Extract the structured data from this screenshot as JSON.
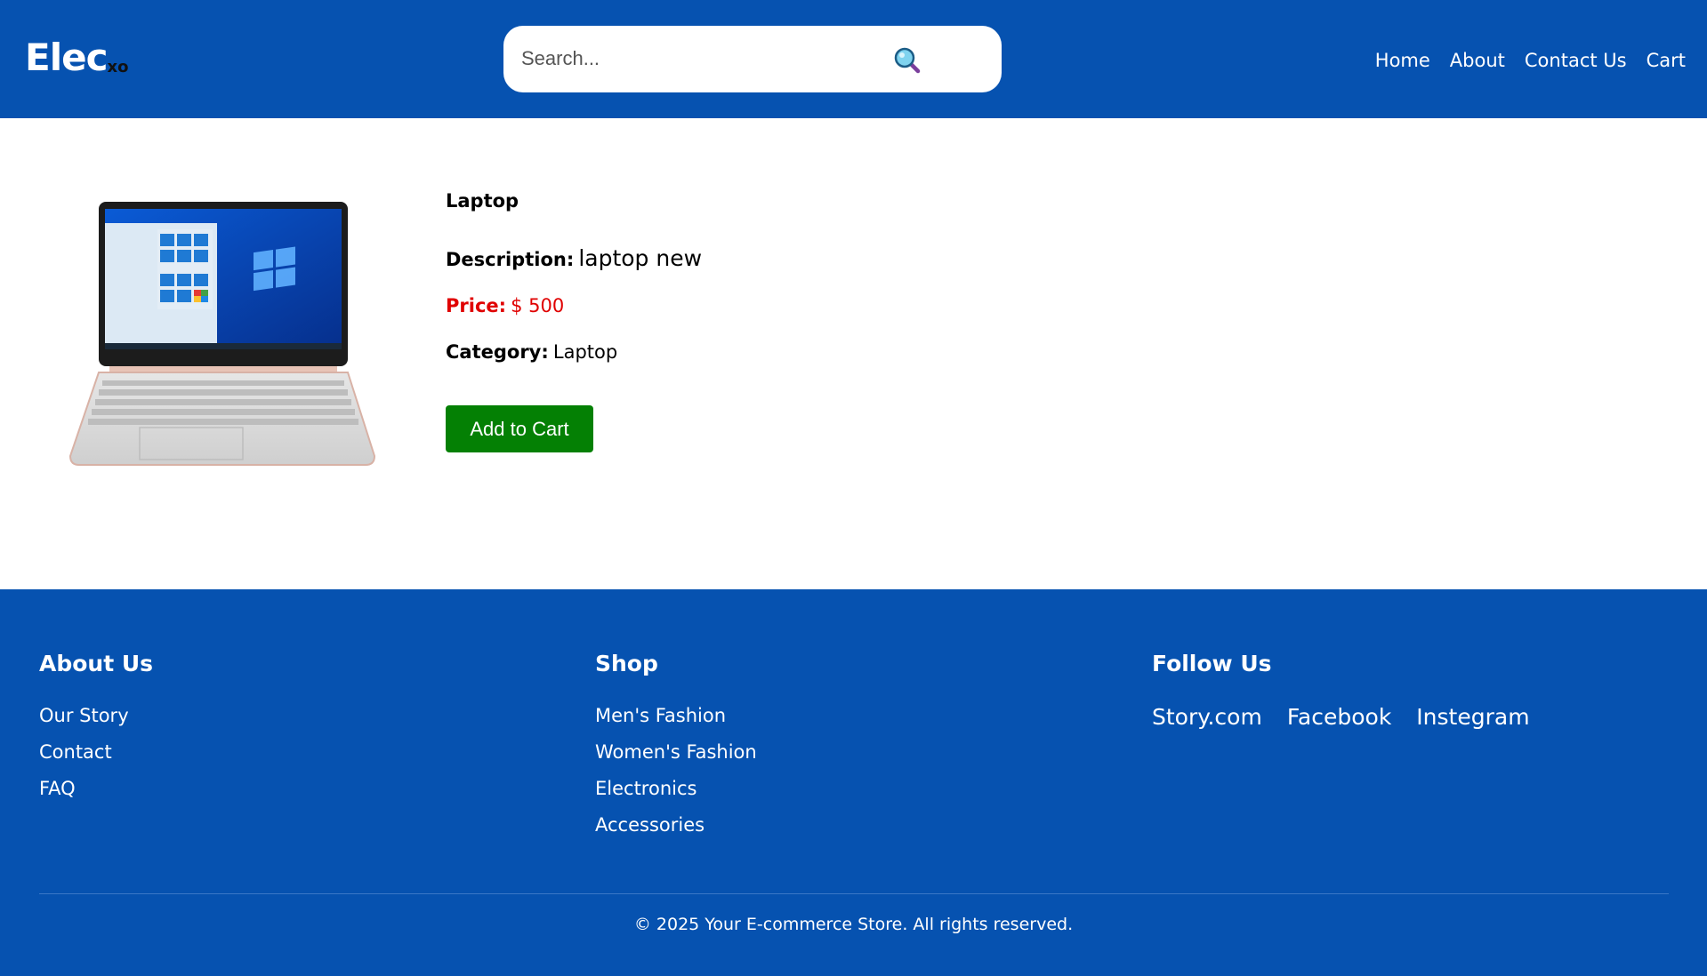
{
  "header": {
    "logo_main": "Elec",
    "logo_sub": "xo",
    "search_placeholder": "Search...",
    "search_icon": "search-icon",
    "nav": [
      "Home",
      "About",
      "Contact Us",
      "Cart"
    ]
  },
  "product": {
    "title": "Laptop",
    "description_label": "Description:",
    "description": "laptop new",
    "price_label": "Price:",
    "price": "$ 500",
    "category_label": "Category:",
    "category": "Laptop",
    "add_to_cart_label": "Add to Cart"
  },
  "footer": {
    "about_heading": "About Us",
    "about_links": [
      "Our Story",
      "Contact",
      "FAQ"
    ],
    "shop_heading": "Shop",
    "shop_links": [
      "Men's Fashion",
      "Women's Fashion",
      "Electronics",
      "Accessories"
    ],
    "follow_heading": "Follow Us",
    "social_links": [
      "Story.com",
      "Facebook",
      "Instegram"
    ],
    "copyright": "© 2025 Your E-commerce Store. All rights reserved."
  },
  "colors": {
    "brand_blue": "#0652b0",
    "price_red": "#e00000",
    "cart_green": "#048004"
  }
}
